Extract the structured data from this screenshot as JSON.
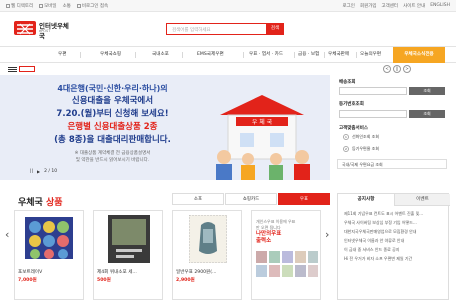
{
  "topbar": {
    "left": [
      "웹 디렉토리",
      "모바일",
      "소통"
    ],
    "mid": "비로그인 접속",
    "right": [
      "로그인",
      "회원가입",
      "고객센터",
      "사이트 안내",
      "ENGLISH"
    ]
  },
  "header": {
    "logo_text": "인터넷우체국",
    "logo_sub": "ePOST",
    "search_placeholder": "검색어를 입력하세요",
    "search_button": "검색"
  },
  "nav": {
    "items": [
      "우편",
      "우체국쇼핑",
      "국내소포",
      "EMS국제우편",
      "우표 · 엽서 · 카드",
      "금융 · 보험",
      "우체국판매",
      "오늘의우편"
    ],
    "special": "우체국소식전용"
  },
  "subbar": {
    "controls": [
      "<",
      "||",
      ">"
    ]
  },
  "banner": {
    "line1": "4대은행(국민·신한·우리·하나)의",
    "line2": "신용대출을 우체국에서",
    "line3": "7.20.(월)부터 신청해 보세요!",
    "line4": "은행별 신용대출상품 2종",
    "line5": "(총 8종)을 대출대리판매합니다.",
    "note1": "※ 대출상품 계약체결 전 금융상품설명서",
    "note2": "및 약관을 반드시 읽어보시기 바랍니다.",
    "counter": "2 / 10",
    "pause": "||",
    "play": "▶",
    "sign": "우 체 국"
  },
  "right_panel": {
    "label1": "배송조회",
    "button1": "조회",
    "label2": "등기번호조회",
    "button2": "조회",
    "label3": "고객맞춤서비스",
    "items": [
      "선화인조회 조회",
      "등기우편물 조회",
      "국내/국제 우편요금 조회"
    ],
    "circle_a": "1",
    "circle_b": "2"
  },
  "products": {
    "title_main": "우체국",
    "title_accent": "상품",
    "tabs": [
      "소포",
      "쇼핑카드",
      "우표"
    ],
    "arrow_prev": "‹",
    "arrow_next": "›",
    "cards": [
      {
        "name": "포보트레이V",
        "price": "7,000원"
      },
      {
        "name": "제4회 위내소포 세...",
        "price": "500원"
      },
      {
        "name": "일반우표 2900원(...",
        "price": "2,900원"
      }
    ],
    "promo_text1": "개인스우표 이용에 우표",
    "promo_text2": "만 오면 됩니다",
    "promo_big1": "나만의우표",
    "promo_big2": "출력소"
  },
  "notice": {
    "tabs": [
      "공지사항",
      "이벤트"
    ],
    "lines": [
      "제11회 기념우표 컨트도 표시 어벤트 진출 및...",
      "우체국 사이버팅 보상심 부정 기입 어떻드...",
      "대한지국우체국판매영업으로 모집환경 안내",
      "인터넷우체국 이름과 안 야류로 안내",
      "이 금내 중 서비스 안드 종료 공지",
      "Hi 전 우거가 비자 소프 우편변 제일 기간"
    ]
  },
  "colors": {
    "brand": "#e2231a",
    "accent": "#f6a622",
    "banner_bg": "#e9edf7",
    "headline_blue": "#1f3c8c"
  }
}
